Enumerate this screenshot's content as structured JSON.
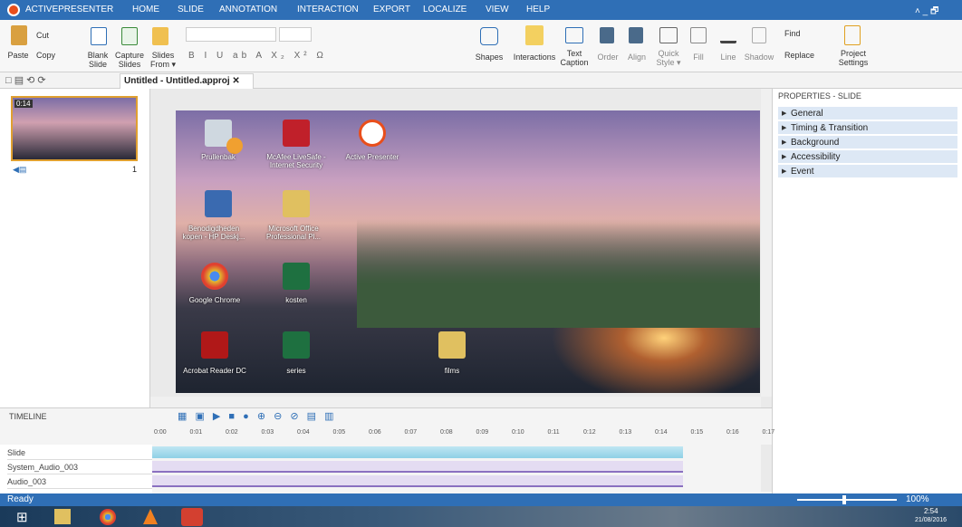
{
  "app": {
    "title": "ACTIVEPRESENTER",
    "tabs": [
      "HOME",
      "SLIDE",
      "ANNOTATION",
      "INTERACTION",
      "EXPORT",
      "LOCALIZE",
      "VIEW",
      "HELP"
    ],
    "window_controls": "˄ _ 🗗"
  },
  "ribbon": {
    "paste": "Paste",
    "cut": "Cut",
    "copy": "Copy",
    "blank_slide": "Blank Slide",
    "capture_slides": "Capture Slides",
    "slides_from": "Slides From ▾",
    "shapes": "Shapes",
    "interactions": "Interactions",
    "text_caption": "Text Caption",
    "order": "Order",
    "align": "Align",
    "quick_style": "Quick Style ▾",
    "fill": "Fill",
    "line": "Line",
    "shadow": "Shadow",
    "find": "Find",
    "replace": "Replace",
    "project_settings": "Project Settings"
  },
  "doc_tab": "Untitled - Untitled.approj ✕",
  "thumb": {
    "time": "0:14",
    "number": "1"
  },
  "desktop": {
    "icons": [
      "Prullenbak",
      "McAfee LiveSafe - Internet Security",
      "Active Presenter",
      "Benodigdheden kopen - HP Deskj...",
      "Microsoft Office Professional Pl...",
      "Google Chrome",
      "kosten",
      "Acrobat Reader DC",
      "series",
      "films"
    ]
  },
  "props": {
    "header": "PROPERTIES - SLIDE",
    "sections": [
      "General",
      "Timing & Transition",
      "Background",
      "Accessibility",
      "Event"
    ]
  },
  "timeline": {
    "header": "TIMELINE",
    "ticks": [
      "0:00",
      "0:01",
      "0:02",
      "0:03",
      "0:04",
      "0:05",
      "0:06",
      "0:07",
      "0:08",
      "0:09",
      "0:10",
      "0:11",
      "0:12",
      "0:13",
      "0:14",
      "0:15",
      "0:16",
      "0:17"
    ],
    "rows": [
      "Slide",
      "System_Audio_003",
      "Audio_003"
    ]
  },
  "status": {
    "text": "Ready",
    "zoom": "100%"
  },
  "taskbar": {
    "time": "2:54",
    "date": "21/08/2016"
  }
}
